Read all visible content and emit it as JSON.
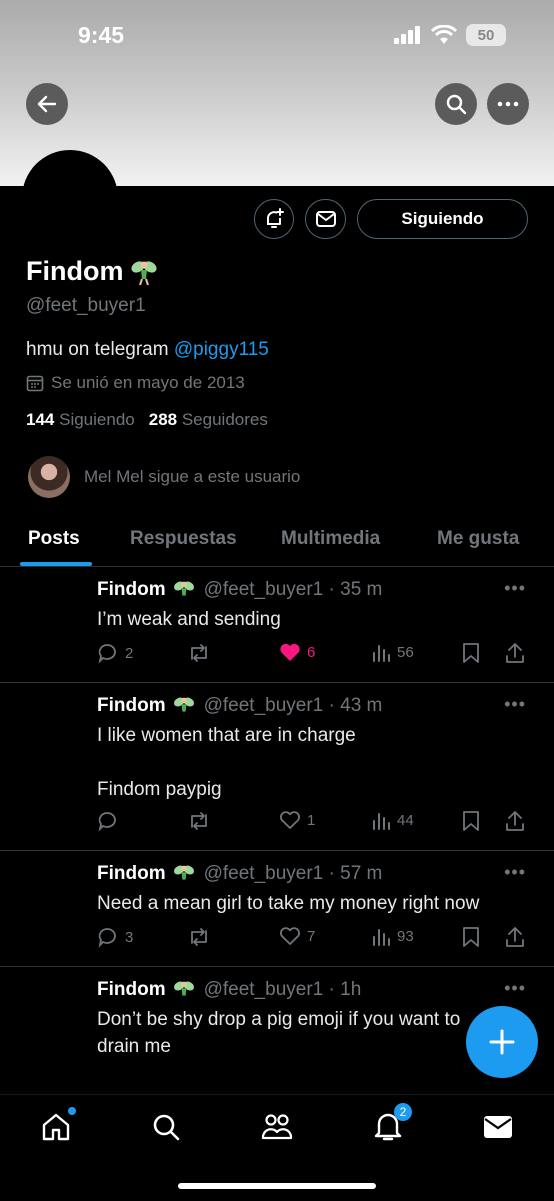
{
  "status_bar": {
    "time": "9:45",
    "battery": "50"
  },
  "profile": {
    "name": "Findom",
    "handle": "@feet_buyer1",
    "bio_text": "hmu on telegram ",
    "bio_link": "@piggy115",
    "joined": "Se unió en mayo de 2013",
    "following_count": "144",
    "following_label": "Siguiendo",
    "followers_count": "288",
    "followers_label": "Seguidores",
    "followed_by": "Mel Mel sigue a este usuario",
    "follow_button": "Siguiendo"
  },
  "tabs": [
    "Posts",
    "Respuestas",
    "Multimedia",
    "Me gusta"
  ],
  "posts": [
    {
      "name": "Findom",
      "meta": "@feet_buyer1 · 35 m",
      "text": "I’m weak and sending",
      "replies": "2",
      "reposts": "",
      "likes": "6",
      "views": "56"
    },
    {
      "name": "Findom",
      "meta": "@feet_buyer1 · 43 m",
      "text": "I like women that are in charge\n\nFindom paypig",
      "replies": "",
      "reposts": "",
      "likes": "1",
      "views": "44"
    },
    {
      "name": "Findom",
      "meta": "@feet_buyer1 · 57 m",
      "text": "Need a mean girl to take my money right now",
      "replies": "3",
      "reposts": "",
      "likes": "7",
      "views": "93"
    },
    {
      "name": "Findom",
      "meta": "@feet_buyer1 · 1h",
      "text": "Don’t be shy drop a pig emoji if you want to\ndrain me",
      "replies": "",
      "reposts": "",
      "likes": "",
      "views": ""
    }
  ],
  "nav": {
    "notifications_badge": "2"
  },
  "icons": {
    "back": "back-arrow-icon",
    "search": "search-icon",
    "more": "more-icon",
    "bell": "notification-bell-icon",
    "mail": "mail-icon",
    "fairy": "fairy-emoji-icon",
    "calendar": "calendar-icon",
    "compose": "plus-icon"
  },
  "colors": {
    "accent": "#1d9bf0",
    "like": "#f91880",
    "muted": "#71767b"
  }
}
